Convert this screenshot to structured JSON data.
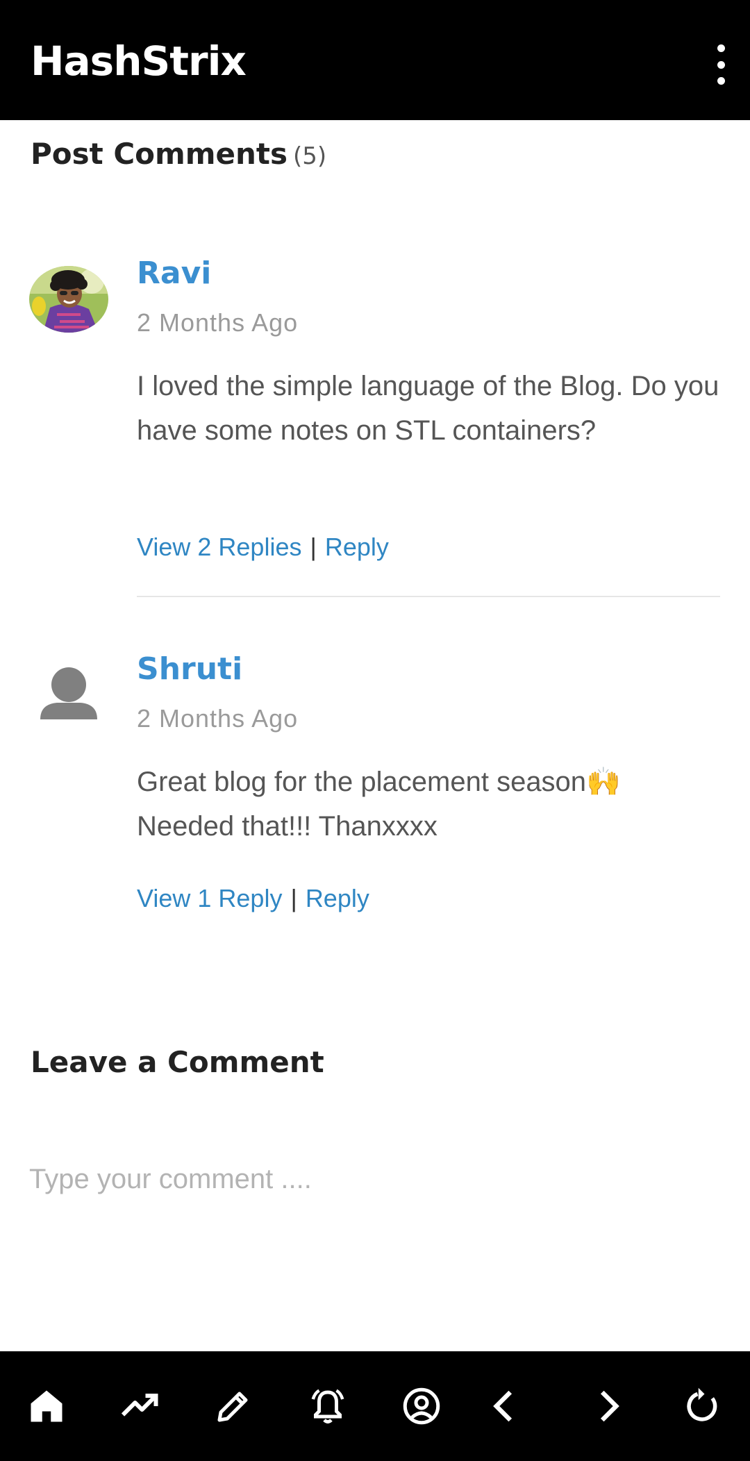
{
  "app": {
    "title": "HashStrix",
    "menu_icon": "more-vertical-icon"
  },
  "comments_section": {
    "title": "Post Comments",
    "count": "(5)",
    "comments": [
      {
        "author": "Ravi",
        "time": "2 Months Ago",
        "text": "I loved the simple language of the Blog. Do you have some notes on STL containers?",
        "view_replies": "View 2 Replies",
        "separator": "|",
        "reply": "Reply"
      },
      {
        "author": "Shruti",
        "time": "2 Months Ago",
        "text": "Great blog for the placement season🙌 Needed that!!! Thanxxxx",
        "view_replies": "View 1 Reply",
        "separator": "|",
        "reply": "Reply"
      }
    ]
  },
  "leave_comment": {
    "title": "Leave a Comment",
    "placeholder": "Type your comment ...."
  },
  "bottom_nav": {
    "items": [
      "home-icon",
      "trending-icon",
      "edit-icon",
      "notifications-icon",
      "account-icon",
      "back-icon",
      "forward-icon",
      "refresh-icon"
    ]
  },
  "colors": {
    "bar_background": "#000000",
    "author_name": "#3b8fd0",
    "link": "#2f86c3",
    "muted_text": "#9a9a9a"
  }
}
